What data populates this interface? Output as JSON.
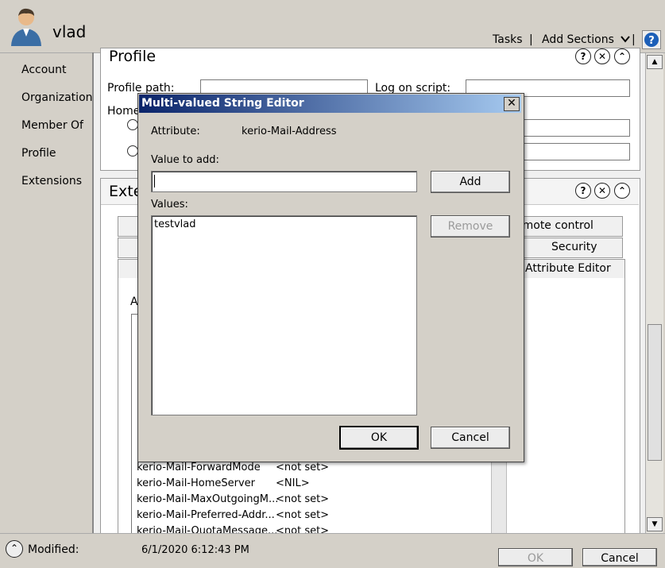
{
  "header": {
    "user_name": "vlad",
    "tasks_label": "Tasks",
    "separator": "|",
    "add_sections_label": "Add Sections",
    "help_label": "?"
  },
  "nav": {
    "items": [
      "Account",
      "Organization",
      "Member Of",
      "Profile",
      "Extensions"
    ]
  },
  "profile_section": {
    "title": "Profile",
    "profile_path_label": "Profile path:",
    "logon_script_label": "Log on script:",
    "home_label": "Home"
  },
  "extensions_section": {
    "title": "Exte",
    "tabs": [
      "emote control",
      "Security",
      "Attribute Editor"
    ],
    "attributes_label": "A",
    "rows": [
      {
        "name": "kerio-Mail-ForwardMode",
        "value": "<not set>"
      },
      {
        "name": "kerio-Mail-HomeServer",
        "value": "<NIL>"
      },
      {
        "name": "kerio-Mail-MaxOutgoingM...",
        "value": "<not set>"
      },
      {
        "name": "kerio-Mail-Preferred-Addr...",
        "value": "<not set>"
      },
      {
        "name": "kerio-Mail-QuotaMessage...",
        "value": "<not set>"
      }
    ]
  },
  "footer": {
    "modified_label": "Modified:",
    "modified_value": "6/1/2020 6:12:43 PM",
    "ok_label": "OK",
    "cancel_label": "Cancel"
  },
  "dialog": {
    "title": "Multi-valued String Editor",
    "close_label": "✕",
    "attribute_label": "Attribute:",
    "attribute_value": "kerio-Mail-Address",
    "value_to_add_label": "Value to add:",
    "value_to_add_current": "",
    "add_label": "Add",
    "values_label": "Values:",
    "values": [
      "testvlad"
    ],
    "remove_label": "Remove",
    "ok_label": "OK",
    "cancel_label": "Cancel"
  },
  "colors": {
    "title_bar_start": "#0a246a",
    "title_bar_end": "#a6caf0",
    "chrome": "#d4d0c8",
    "help_accent": "#1c5fb8"
  }
}
